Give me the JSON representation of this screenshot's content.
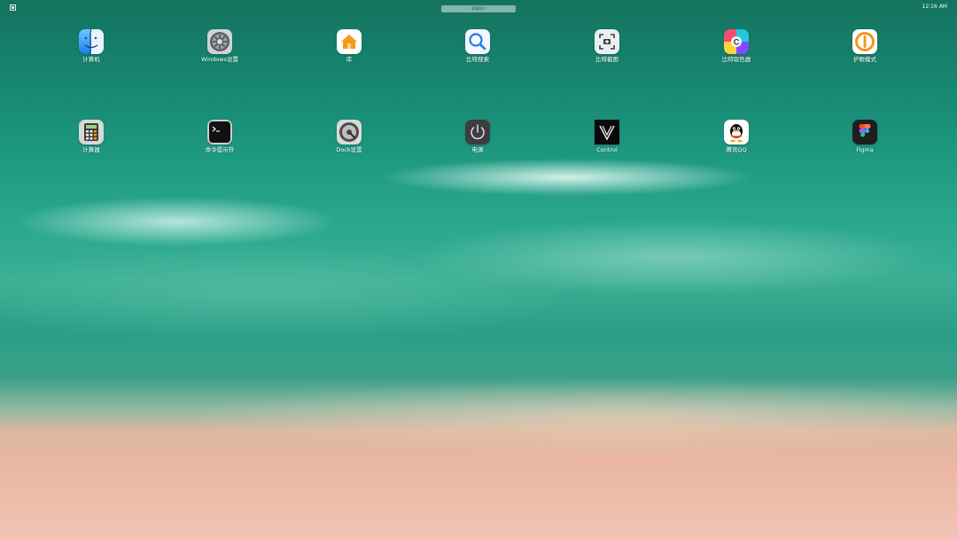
{
  "status_bar": {
    "center_label": "屏幕居中",
    "time": "12:16 AM"
  },
  "apps": [
    {
      "label": "计算机",
      "icon": "finder-icon"
    },
    {
      "label": "Windows设置",
      "icon": "gear-icon"
    },
    {
      "label": "库",
      "icon": "home-icon"
    },
    {
      "label": "比特搜索",
      "icon": "search-icon"
    },
    {
      "label": "比特截图",
      "icon": "screenshot-icon"
    },
    {
      "label": "比特取色器",
      "icon": "color-picker-icon"
    },
    {
      "label": "护眼模式",
      "icon": "eye-care-icon"
    },
    {
      "label": "计算器",
      "icon": "calculator-icon"
    },
    {
      "label": "命令提示符",
      "icon": "terminal-icon"
    },
    {
      "label": "Dock设置",
      "icon": "dock-settings-icon"
    },
    {
      "label": "电源",
      "icon": "power-icon"
    },
    {
      "label": "Control",
      "icon": "control-icon"
    },
    {
      "label": "腾讯QQ",
      "icon": "qq-icon"
    },
    {
      "label": "Figma",
      "icon": "figma-icon"
    }
  ]
}
